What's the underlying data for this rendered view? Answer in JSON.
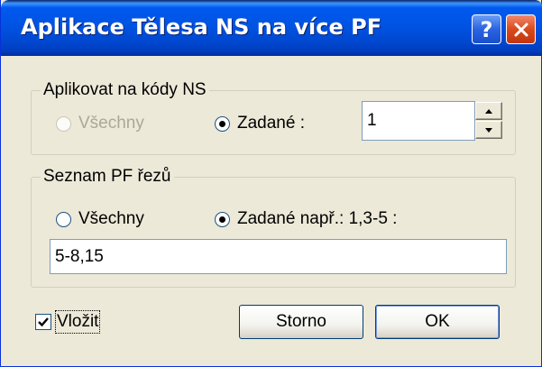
{
  "window": {
    "title": "Aplikace Tělesa NS na více PF",
    "help_label": "?",
    "close_icon": "close-icon"
  },
  "ns_group": {
    "legend": "Aplikovat na kódy NS",
    "all_label": "Všechny",
    "specified_label": "Zadané :",
    "selected": "specified",
    "all_enabled": false,
    "value": "1"
  },
  "pf_group": {
    "legend": "Seznam PF řezů",
    "all_label": "Všechny",
    "specified_label": "Zadané např.: 1,3-5 :",
    "selected": "specified",
    "value": "5-8,15"
  },
  "insert_checkbox": {
    "label": "Vložit",
    "checked": true
  },
  "buttons": {
    "cancel": "Storno",
    "ok": "OK"
  }
}
